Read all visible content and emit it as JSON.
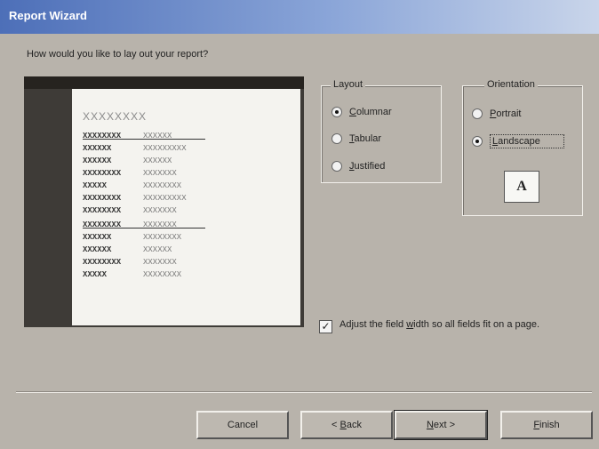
{
  "window": {
    "title": "Report Wizard"
  },
  "prompt": "How would you like to lay out your report?",
  "preview": {
    "title": "XXXXXXXX",
    "rows": [
      {
        "a": "XXXXXXXX",
        "b": "XXXXXX"
      },
      {
        "a": "XXXXXX",
        "b": "XXXXXXXXX"
      },
      {
        "a": "XXXXXX",
        "b": "XXXXXX"
      },
      {
        "a": "XXXXXXXX",
        "b": "XXXXXXX"
      },
      {
        "a": "XXXXX",
        "b": "XXXXXXXX"
      },
      {
        "a": "XXXXXXXX",
        "b": "XXXXXXXXX"
      },
      {
        "a": "XXXXXXXX",
        "b": "XXXXXXX"
      },
      {
        "a": "XXXXXXXX",
        "b": "XXXXXXX"
      },
      {
        "a": "XXXXXX",
        "b": "XXXXXXXX"
      },
      {
        "a": "XXXXXX",
        "b": "XXXXXX"
      },
      {
        "a": "XXXXXXXX",
        "b": "XXXXXXX"
      },
      {
        "a": "XXXXX",
        "b": "XXXXXXXX"
      }
    ]
  },
  "layout": {
    "legend": "Layout",
    "options": [
      {
        "underline": "C",
        "rest": "olumnar",
        "selected": true
      },
      {
        "underline": "T",
        "rest": "abular",
        "selected": false
      },
      {
        "underline": "J",
        "rest": "ustified",
        "selected": false
      }
    ]
  },
  "orientation": {
    "legend": "Orientation",
    "options": [
      {
        "underline": "P",
        "rest": "ortrait",
        "selected": false
      },
      {
        "underline": "L",
        "rest": "andscape",
        "selected": true
      }
    ],
    "sample_letter": "A"
  },
  "adjust": {
    "checked": true,
    "label_before": "Adjust the field ",
    "label_underline": "w",
    "label_after": "idth so all fields fit on a page."
  },
  "buttons": {
    "cancel": "Cancel",
    "back": {
      "prefix": "< ",
      "underline": "B",
      "rest": "ack"
    },
    "next": {
      "underline": "N",
      "rest": "ext >"
    },
    "finish": {
      "underline": "F",
      "rest": "inish"
    }
  },
  "icons": {
    "checkmark": "✓"
  }
}
